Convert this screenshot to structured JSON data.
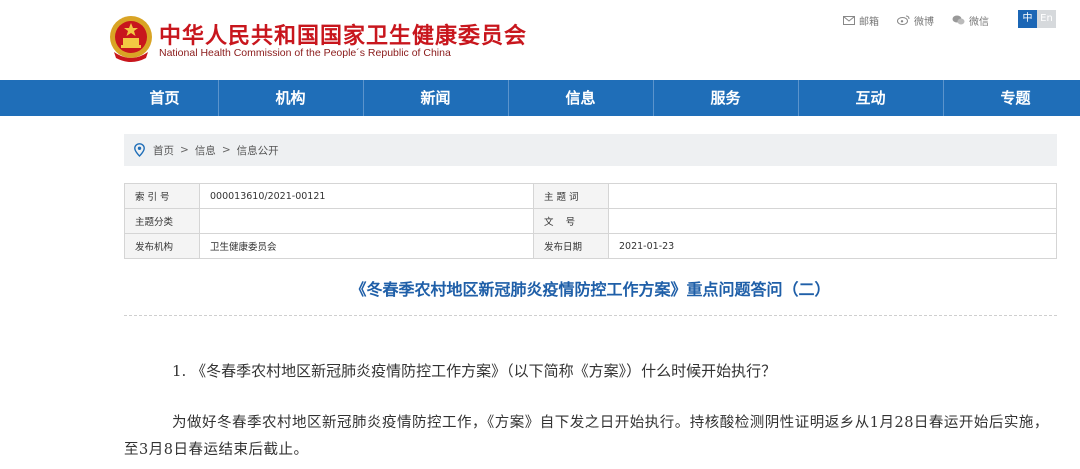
{
  "header": {
    "title": "中华人民共和国国家卫生健康委员会",
    "subtitle": "National Health Commission of the People´s Republic of China",
    "links": [
      {
        "label": "邮箱",
        "icon": "mail-icon"
      },
      {
        "label": "微博",
        "icon": "weibo-icon"
      },
      {
        "label": "微信",
        "icon": "wechat-icon"
      }
    ],
    "lang": {
      "zh": "中",
      "en": "En"
    }
  },
  "nav": {
    "items": [
      "首页",
      "机构",
      "新闻",
      "信息",
      "服务",
      "互动",
      "专题"
    ]
  },
  "breadcrumb": {
    "items": [
      "首页",
      "信息",
      "信息公开"
    ],
    "separator": ">"
  },
  "meta": {
    "index_label": "索 引 号",
    "index_value": "000013610/2021-00121",
    "subject_word_label": "主 题 词",
    "subject_word_value": "",
    "category_label": "主题分类",
    "category_value": "",
    "doc_no_label": "文    号",
    "doc_no_value": "",
    "issuer_label": "发布机构",
    "issuer_value": "卫生健康委员会",
    "date_label": "发布日期",
    "date_value": "2021-01-23"
  },
  "article": {
    "title": "《冬春季农村地区新冠肺炎疫情防控工作方案》重点问题答问（二）",
    "question1": "1. 《冬春季农村地区新冠肺炎疫情防控工作方案》（以下简称《方案》）什么时候开始执行？",
    "answer1": "为做好冬春季农村地区新冠肺炎疫情防控工作，《方案》自下发之日开始执行。持核酸检测阴性证明返乡从1月28日春运开始后实施，至3月8日春运结束后截止。"
  },
  "colors": {
    "brand_red": "#c8161d",
    "nav_blue": "#1f6eb8",
    "title_blue": "#1f5fa8"
  }
}
